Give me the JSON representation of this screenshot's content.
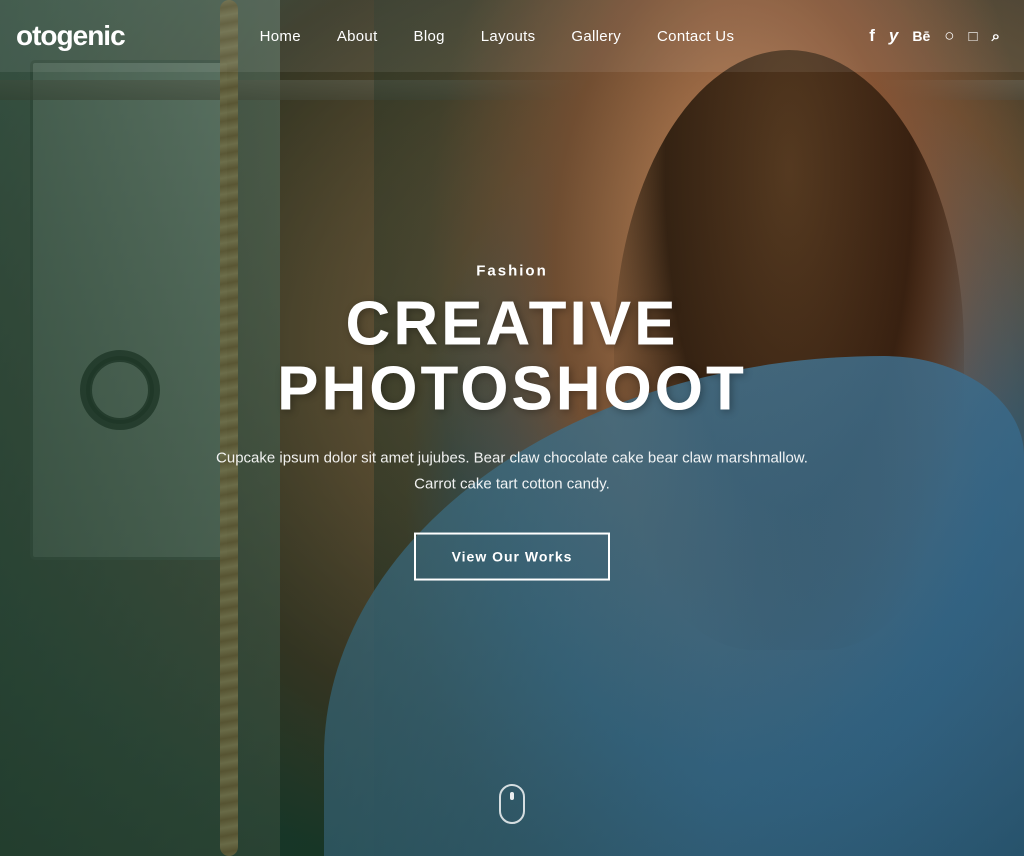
{
  "brand": {
    "logo": "otogenic"
  },
  "nav": {
    "items": [
      {
        "id": "home",
        "label": "Home"
      },
      {
        "id": "about",
        "label": "About"
      },
      {
        "id": "blog",
        "label": "Blog"
      },
      {
        "id": "layouts",
        "label": "Layouts"
      },
      {
        "id": "gallery",
        "label": "Gallery"
      },
      {
        "id": "contact",
        "label": "Contact Us"
      }
    ]
  },
  "social": {
    "icons": [
      {
        "id": "facebook",
        "symbol": "f",
        "label": "Facebook"
      },
      {
        "id": "twitter",
        "symbol": "𝕏",
        "label": "Twitter"
      },
      {
        "id": "behance",
        "symbol": "Bē",
        "label": "Behance"
      },
      {
        "id": "github",
        "symbol": "⊙",
        "label": "GitHub"
      },
      {
        "id": "instagram",
        "symbol": "◫",
        "label": "Instagram"
      },
      {
        "id": "search",
        "symbol": "🔍",
        "label": "Search"
      }
    ]
  },
  "hero": {
    "category": "Fashion",
    "title": "CREATIVE PHOTOSHOOT",
    "description": "Cupcake ipsum dolor sit amet jujubes. Bear claw chocolate cake bear claw marshmallow. Carrot cake tart cotton candy.",
    "cta_label": "View Our Works"
  }
}
